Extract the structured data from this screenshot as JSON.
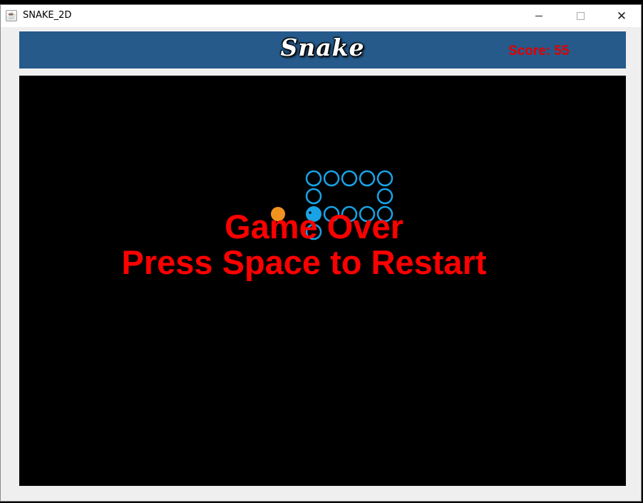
{
  "window": {
    "title": "SNAKE_2D",
    "icon": "java-cup-icon",
    "controls": [
      "minimize",
      "maximize",
      "close"
    ],
    "close_glyph": "✕"
  },
  "header": {
    "logo": "Snake",
    "score_text": "Score: 55",
    "background": "#255a8b",
    "score_color": "#e20000"
  },
  "game": {
    "state": "game over",
    "message_line1": "Game Over",
    "message_line2": "Press Space to Restart",
    "message_color": "#ff0000",
    "snake_color": "#19a3e6",
    "food_color": "#f29320",
    "board_background": "#000000"
  }
}
